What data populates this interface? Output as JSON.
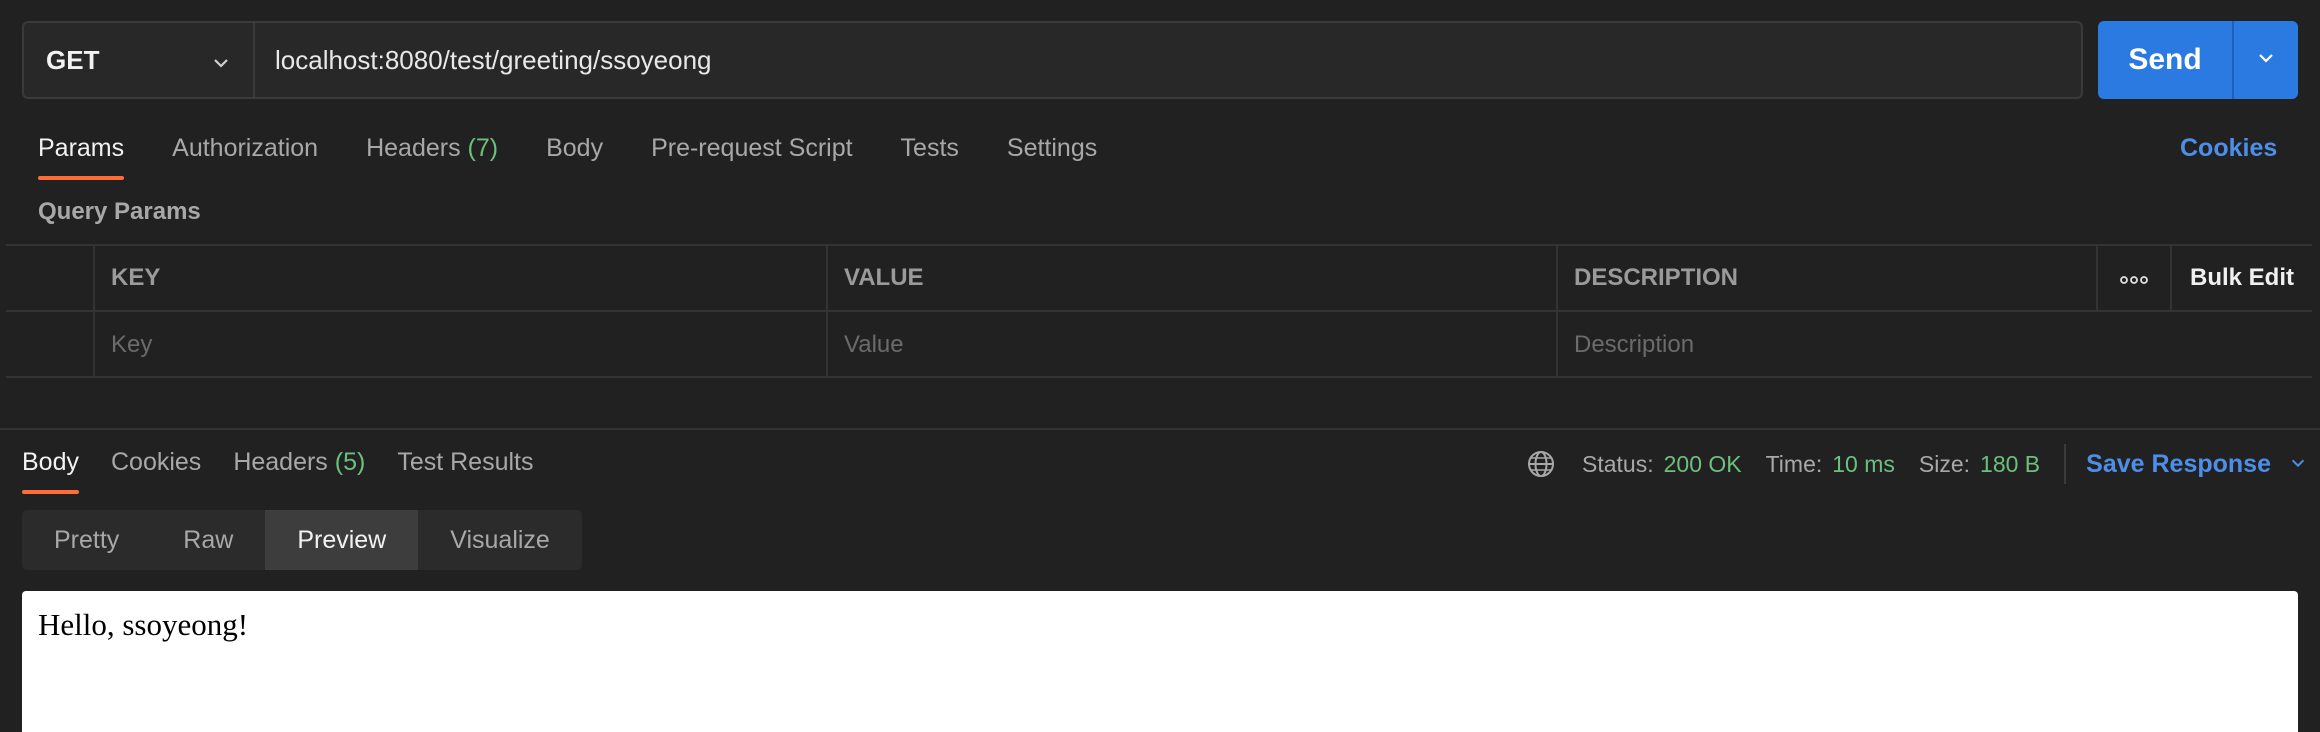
{
  "request": {
    "method": "GET",
    "url": "localhost:8080/test/greeting/ssoyeong",
    "send_label": "Send"
  },
  "request_tabs": [
    {
      "label": "Params",
      "active": true
    },
    {
      "label": "Authorization"
    },
    {
      "label": "Headers",
      "count": "(7)"
    },
    {
      "label": "Body"
    },
    {
      "label": "Pre-request Script"
    },
    {
      "label": "Tests"
    },
    {
      "label": "Settings"
    }
  ],
  "cookies_label": "Cookies",
  "query_params": {
    "title": "Query Params",
    "headers": {
      "key": "KEY",
      "value": "VALUE",
      "description": "DESCRIPTION",
      "bulk_edit": "Bulk Edit"
    },
    "placeholders": {
      "key": "Key",
      "value": "Value",
      "description": "Description"
    }
  },
  "response_tabs": [
    {
      "label": "Body",
      "active": true
    },
    {
      "label": "Cookies"
    },
    {
      "label": "Headers",
      "count": "(5)"
    },
    {
      "label": "Test Results"
    }
  ],
  "response_status": {
    "status_label": "Status:",
    "status_value": "200 OK",
    "time_label": "Time:",
    "time_value": "10 ms",
    "size_label": "Size:",
    "size_value": "180 B",
    "save_label": "Save Response"
  },
  "view_modes": [
    {
      "label": "Pretty"
    },
    {
      "label": "Raw"
    },
    {
      "label": "Preview",
      "active": true
    },
    {
      "label": "Visualize"
    }
  ],
  "preview_text": "Hello, ssoyeong!",
  "colors": {
    "accent": "#2a7ae2",
    "active_tab": "#ff6c37",
    "success": "#6cc07e",
    "link": "#4d8ee8"
  }
}
